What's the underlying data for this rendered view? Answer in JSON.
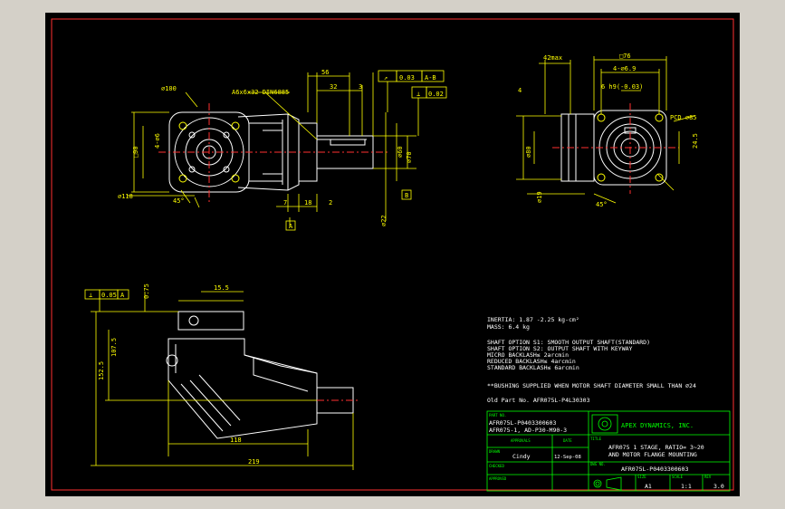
{
  "window": {
    "title": ""
  },
  "drawing": {
    "top_view": {
      "leader_pcd100": "⌀100",
      "flat_45": "45°",
      "keyway_note": "A6x6x32 DIN6885",
      "dim_56": "56",
      "dim_32": "32",
      "dim_3": "3",
      "dim_7": "7",
      "dim_18": "18",
      "dim_2": "2",
      "dim_118": "⌀118",
      "dim_4x6": "4-⌀6",
      "dim_90": "□90",
      "dim_60": "⌀60",
      "dim_70": "⌀70",
      "dim_22": "⌀22",
      "gtol1_sym": "↗",
      "gtol1_val": "0.03",
      "gtol1_ref": "A-B",
      "gtol2_sym": "⊥",
      "gtol2_val": "0.02",
      "gtol2_ref": "B",
      "datum_a": "A",
      "datum_b": "B"
    },
    "side_view": {
      "dim_42max": "42max",
      "dim_76": "□76",
      "dim_4x69": "4-⌀6.9",
      "dim_6h9": "6 h9(-0.03)",
      "dim_pcd": "PCD ⌀85",
      "dim_245": "24.5",
      "dim_angle": "45°",
      "dim_80": "⌀80",
      "dim_19": "⌀19",
      "dim_4": "4"
    },
    "front_view": {
      "gtol_sym": "⊥",
      "gtol_val": "0.05",
      "gtol_ref": "A",
      "dim_075": "0.75",
      "dim_155": "15.5",
      "dim_1075": "107.5",
      "dim_1525": "152.5",
      "dim_118": "118",
      "dim_219": "219"
    },
    "notes": [
      "INERTIA:  1.87 -2.25 kg-cm²",
      "MASS: 6.4 kg",
      "",
      "SHAFT OPTION S1: SMOOTH OUTPUT SHAFT(STANDARD)",
      "SHAFT OPTION S2: OUTPUT SHAFT WITH KEYWAY",
      "MICRO BACKLASH≤ 2arcmin",
      "REDUCED BACKLASH≤ 4arcmin",
      "STANDARD BACKLASH≤ 6arcmin",
      "",
      "**BUSHING SUPPLIED WHEN MOTOR SHAFT DIAMETER SMALL THAN ⌀24",
      "",
      "Old Part No. AFR075L-P4L30303"
    ],
    "title_block": {
      "part_no_label": "PART NO.",
      "part_no_1": "AFR075L-P0403300603",
      "part_no_2": "AFR075-1, AD-P30-M90-3",
      "approved_label": "APPROVALS",
      "date_label": "DATE",
      "drawn_label": "DRAWN",
      "drawn_by": "Cindy",
      "drawn_date": "12-Sep-08",
      "checked_label": "CHECKED",
      "approved_row_label": "APPROVED",
      "company": "APEX DYNAMICS, INC.",
      "title_label": "TITLE",
      "title_line1": "AFR075 1 STAGE, RATIO= 3~20",
      "title_line2": "AND MOTOR FLANGE MOUNTING",
      "dwg_no_label": "DWG NO.",
      "dwg_no": "AFR075L-P0403300603",
      "size_label": "SIZE",
      "size": "A1",
      "scale_label": "SCALE",
      "scale": "1:1",
      "rev_label": "REV",
      "rev": "3.0"
    }
  }
}
